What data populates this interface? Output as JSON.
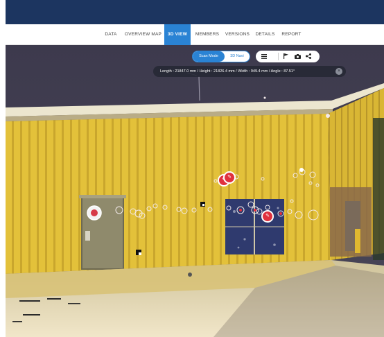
{
  "nav": {
    "tabs": [
      {
        "label": "DATA"
      },
      {
        "label": "OVERVIEW MAP"
      },
      {
        "label": "3D VIEW"
      },
      {
        "label": "MEMBERS"
      },
      {
        "label": "VERSIONS"
      },
      {
        "label": "DETAILS"
      },
      {
        "label": "REPORT"
      }
    ],
    "active_tab": "3D VIEW"
  },
  "viewer": {
    "mode_toggle": {
      "active_label": "Scan Mode",
      "inactive_label": "3D Navi"
    },
    "toolbar": {
      "icons": [
        "list-icon",
        "flag-icon",
        "camera-icon",
        "share-icon"
      ]
    },
    "measurement": {
      "text": "Length : 21847.0 mm  /  Height : 21826.4 mm  /  Width : 949.4 mm  /  Angle : 87.51°",
      "close_glyph": "×"
    },
    "pins": {
      "glyph": "✎",
      "color": "#e0313d"
    }
  },
  "colors": {
    "header": "#1c3560",
    "accent": "#2a83d4",
    "wall": "#e3c13a"
  }
}
